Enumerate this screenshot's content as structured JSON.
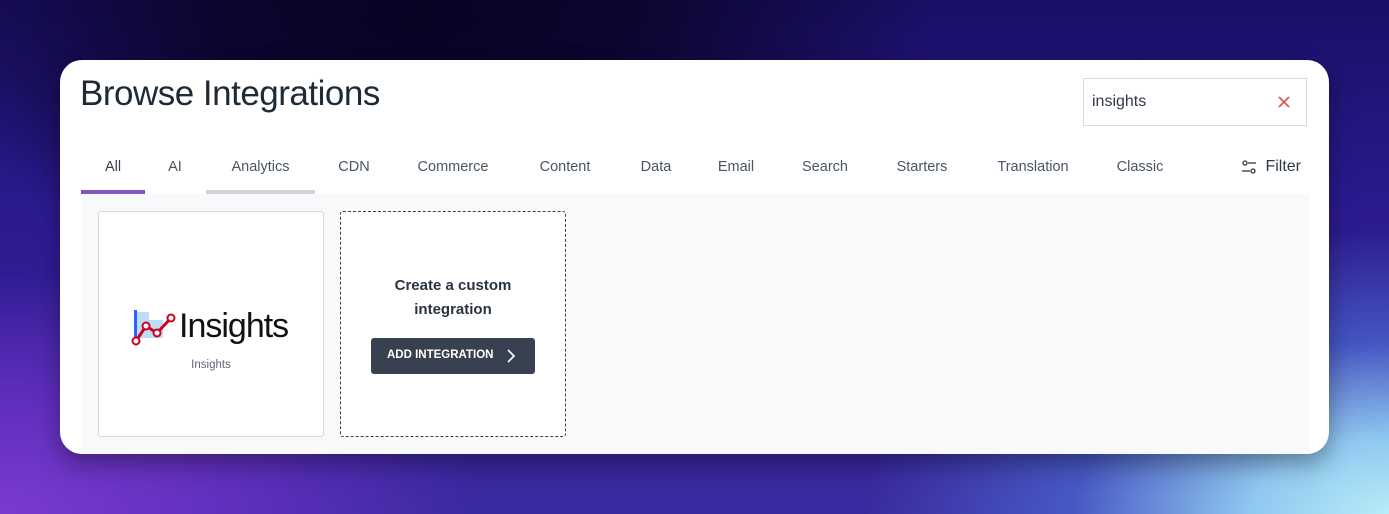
{
  "page": {
    "title": "Browse Integrations"
  },
  "search": {
    "value": "insights",
    "clear_icon": "close-icon",
    "clear_color": "#e05252"
  },
  "tabs": [
    {
      "label": "All",
      "active": true
    },
    {
      "label": "AI"
    },
    {
      "label": "Analytics",
      "hovered": true
    },
    {
      "label": "CDN"
    },
    {
      "label": "Commerce"
    },
    {
      "label": "Content"
    },
    {
      "label": "Data"
    },
    {
      "label": "Email"
    },
    {
      "label": "Search"
    },
    {
      "label": "Starters"
    },
    {
      "label": "Translation"
    },
    {
      "label": "Classic"
    }
  ],
  "filter": {
    "label": "Filter",
    "icon": "sliders-icon"
  },
  "results": [
    {
      "name": "Insights",
      "logo_text": "Insights",
      "logo_icon": "line-chart-icon"
    }
  ],
  "custom_card": {
    "title_line1": "Create a custom",
    "title_line2": "integration",
    "button_label": "ADD INTEGRATION",
    "button_icon": "chevron-right-icon"
  },
  "colors": {
    "accent": "#7e57c2",
    "button_bg": "#38414f",
    "logo_red": "#d0021b",
    "logo_blue": "#2962ff"
  }
}
